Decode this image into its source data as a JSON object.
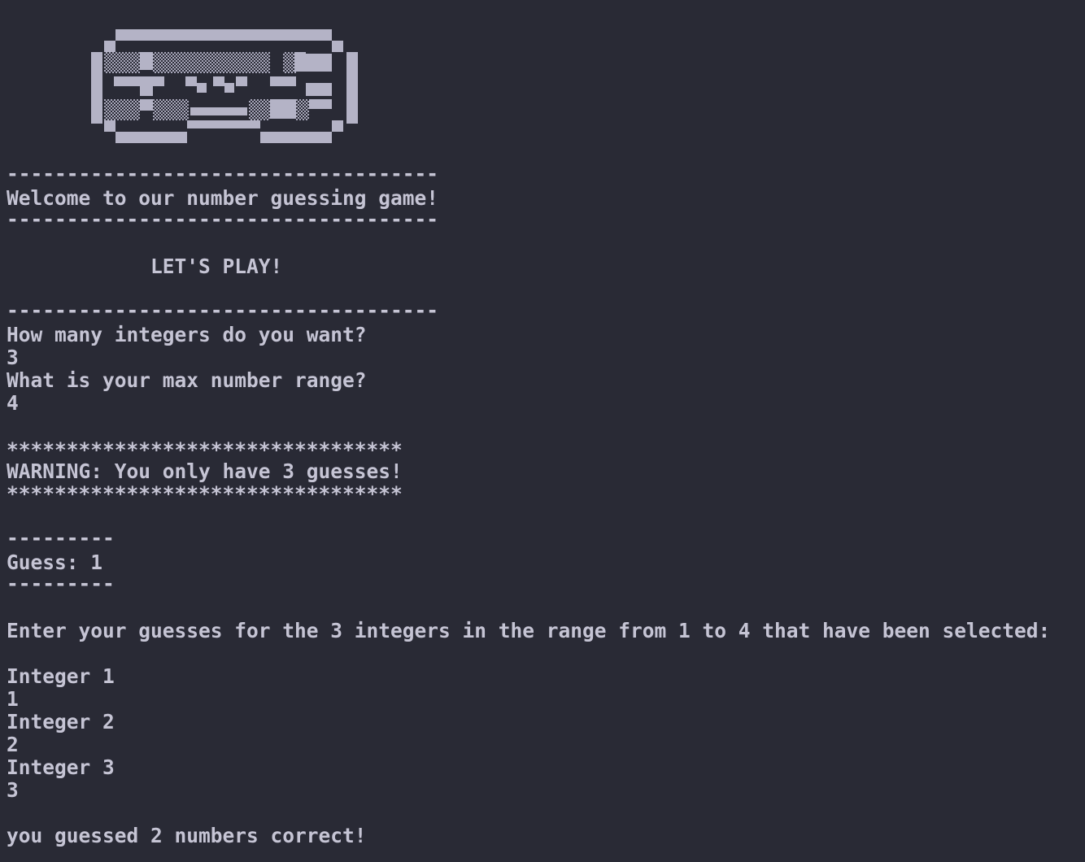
{
  "colors": {
    "background": "#292a35",
    "text": "#c5c4d4"
  },
  "logo": {
    "icon": "gamepad-ascii-art-icon"
  },
  "output": {
    "rule_top": "------------------------------------",
    "welcome": "Welcome to our number guessing game!",
    "rule_mid": "------------------------------------",
    "lets_play": "            LET'S PLAY!",
    "rule_play": "------------------------------------",
    "q_integers": "How many integers do you want?",
    "a_integers": "3",
    "q_range": "What is your max number range?",
    "a_range": "4",
    "stars_top": "*********************************",
    "warning": "WARNING: You only have 3 guesses!",
    "stars_bottom": "*********************************",
    "guess_rule_top": "---------",
    "guess_label": "Guess: 1",
    "guess_rule_bottom": "---------",
    "prompt": "Enter your guesses for the 3 integers in the range from 1 to 4 that have been selected:",
    "int1_label": "Integer 1",
    "int1_value": "1",
    "int2_label": "Integer 2",
    "int2_value": "2",
    "int3_label": "Integer 3",
    "int3_value": "3",
    "result": "you guessed 2 numbers correct!"
  }
}
